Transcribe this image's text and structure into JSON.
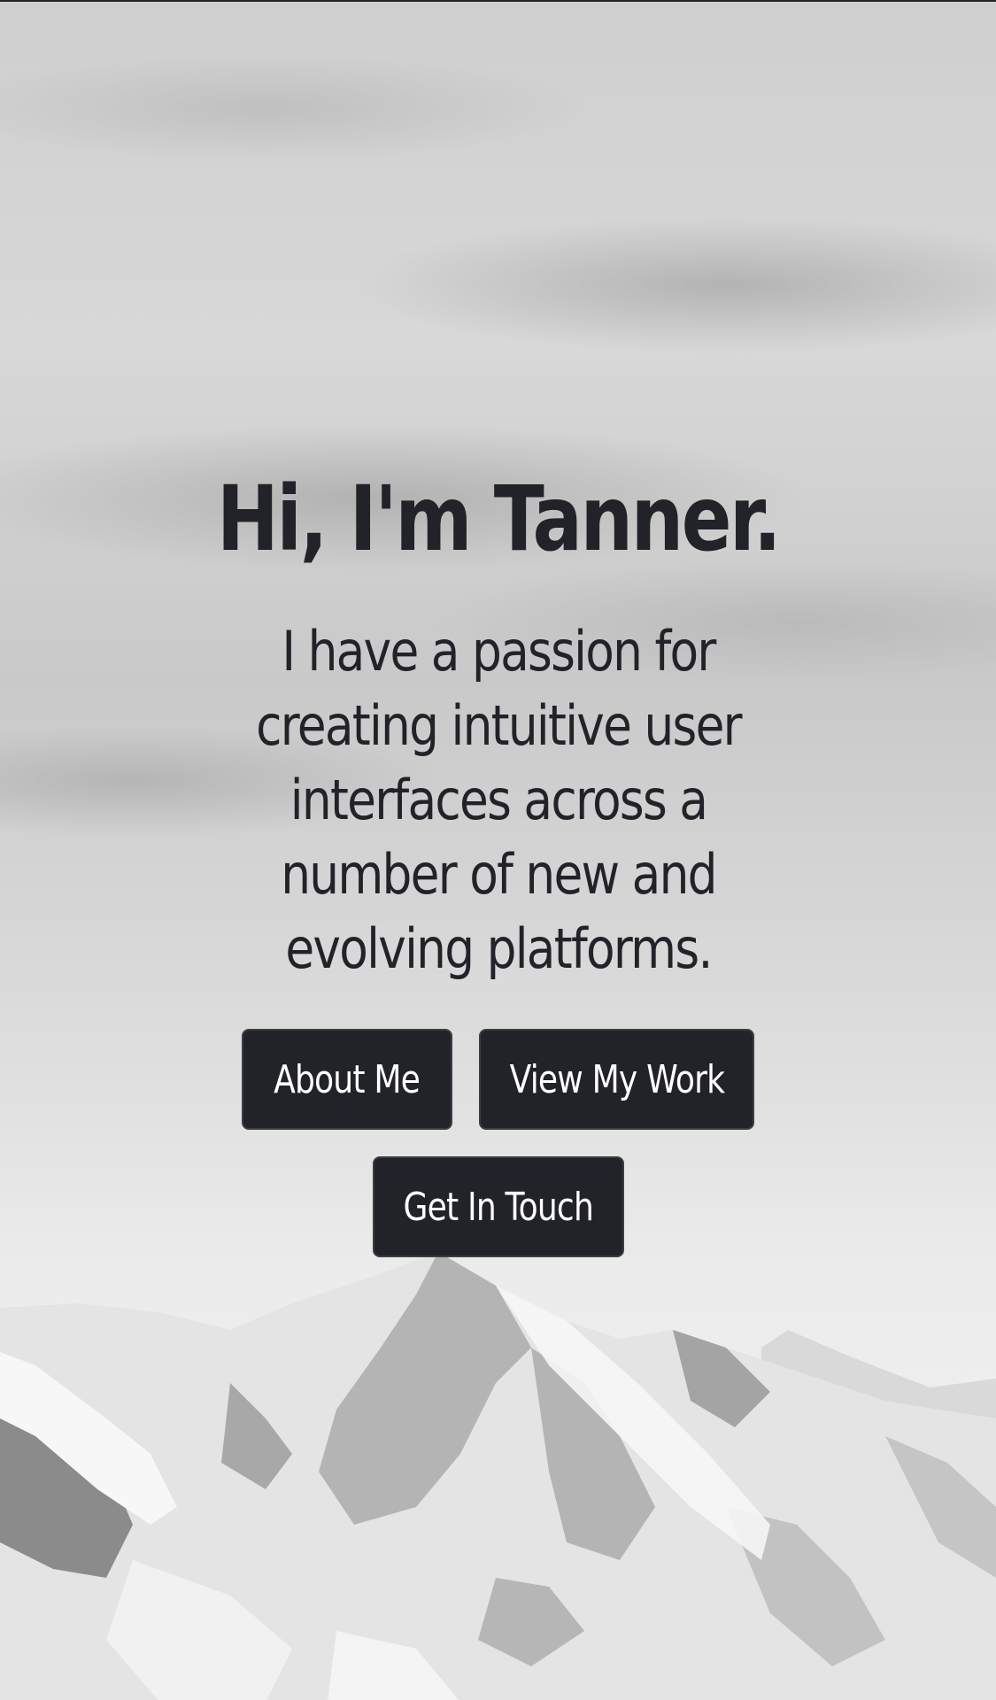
{
  "hero": {
    "title": "Hi, I'm Tanner.",
    "subtitle": "I have a passion for creating intuitive user interfaces across a number of new and evolving platforms."
  },
  "buttons": {
    "about": "About Me",
    "work": "View My Work",
    "contact": "Get In Touch"
  },
  "colors": {
    "text": "#212328",
    "button_bg": "#212328",
    "button_text": "#ffffff"
  }
}
